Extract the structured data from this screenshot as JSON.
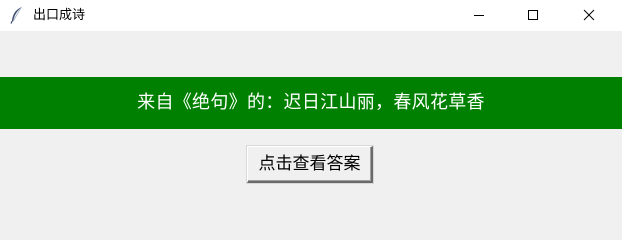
{
  "window": {
    "title": "出口成诗",
    "icon": "feather-icon",
    "controls": {
      "minimize_icon": "minimize-icon",
      "maximize_icon": "maximize-icon",
      "close_icon": "close-icon"
    }
  },
  "main": {
    "question_text": "来自《绝句》的：迟日江山丽，春风花草香",
    "answer_button_label": "点击查看答案"
  },
  "colors": {
    "banner_background": "#008000",
    "banner_text": "#ffffff",
    "window_background": "#f0f0f0",
    "titlebar_background": "#ffffff"
  }
}
